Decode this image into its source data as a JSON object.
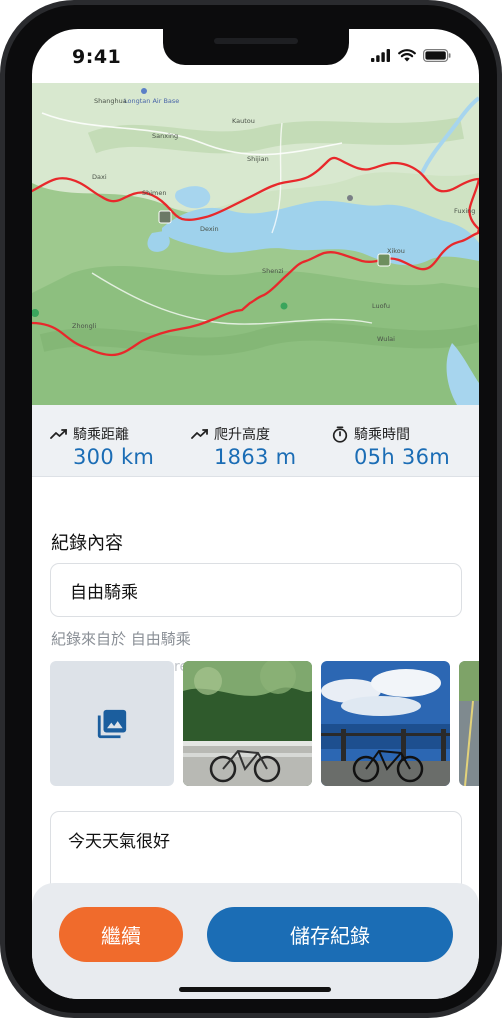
{
  "status_bar": {
    "time": "9:41"
  },
  "map": {
    "labels": [
      "Longtan Air Base",
      "Shanghua",
      "Sanxing",
      "Daxi",
      "Shimen",
      "Shijian",
      "Dexin",
      "Xikou",
      "Zhongli",
      "Luofu",
      "Fuxing",
      "Shenzi",
      "Kautou",
      "Wulai"
    ],
    "route_color": "#e8282b"
  },
  "stats": {
    "distance": {
      "label": "騎乘距離",
      "value": "300 km",
      "icon": "trend-up-icon"
    },
    "elevation": {
      "label": "爬升高度",
      "value": "1863 m",
      "icon": "trend-up-icon"
    },
    "duration": {
      "label": "騎乘時間",
      "value": "05h 36m",
      "icon": "stopwatch-icon"
    }
  },
  "form": {
    "section_title": "紀錄內容",
    "title_value": "自由騎乘",
    "source_note": "紀錄來自於 自由騎乘",
    "ghost_text": "re",
    "add_photo_icon": "photo-library-icon",
    "note_value": "今天天氣很好"
  },
  "actions": {
    "continue_label": "繼續",
    "save_label": "儲存紀錄"
  },
  "colors": {
    "accent_blue": "#1b6db5",
    "accent_orange": "#f06b2c"
  }
}
